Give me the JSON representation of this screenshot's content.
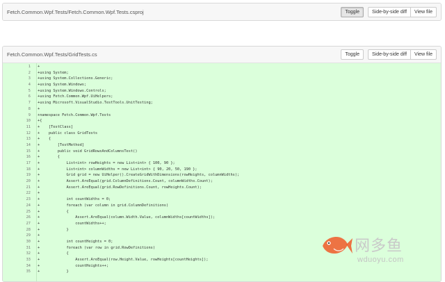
{
  "files": [
    {
      "path": "Fetch.Common.Wpf.Tests/Fetch.Common.Wpf.Tests.csproj",
      "toggle_label": "Toggle",
      "side_by_side_label": "Side-by-side diff",
      "view_file_label": "View file"
    },
    {
      "path": "Fetch.Common.Wpf.Tests/GridTests.cs",
      "toggle_label": "Toggle",
      "side_by_side_label": "Side-by-side diff",
      "view_file_label": "View file",
      "lines": [
        {
          "num": "1",
          "text": "+"
        },
        {
          "num": "2",
          "text": "+using System;"
        },
        {
          "num": "3",
          "text": "+using System.Collections.Generic;"
        },
        {
          "num": "4",
          "text": "+using System.Windows;"
        },
        {
          "num": "5",
          "text": "+using System.Windows.Controls;"
        },
        {
          "num": "6",
          "text": "+using Fetch.Common.Wpf.UiHelpers;"
        },
        {
          "num": "7",
          "text": "+using Microsoft.VisualStudio.TestTools.UnitTesting;"
        },
        {
          "num": "8",
          "text": "+"
        },
        {
          "num": "9",
          "text": "+namespace Fetch.Common.Wpf.Tests"
        },
        {
          "num": "10",
          "text": "+{"
        },
        {
          "num": "11",
          "text": "+    [TestClass]"
        },
        {
          "num": "12",
          "text": "+    public class GridTests"
        },
        {
          "num": "13",
          "text": "+    {"
        },
        {
          "num": "14",
          "text": "+        [TestMethod]"
        },
        {
          "num": "15",
          "text": "+        public void GridRowsAndColumnsTest()"
        },
        {
          "num": "16",
          "text": "+        {"
        },
        {
          "num": "17",
          "text": "+            List<int> rowHeights = new List<int> { 100, 90 };"
        },
        {
          "num": "18",
          "text": "+            List<int> columnWidths = new List<int> { 90, 20, 50, 190 };"
        },
        {
          "num": "19",
          "text": "+            Grid grid = new UiHelper().CreateGridWithDimensions(rowHeights, columnWidths);"
        },
        {
          "num": "20",
          "text": "+            Assert.AreEqual(grid.ColumnDefinitions.Count, columnWidths.Count);"
        },
        {
          "num": "21",
          "text": "+            Assert.AreEqual(grid.RowDefinitions.Count, rowHeights.Count);"
        },
        {
          "num": "22",
          "text": "+"
        },
        {
          "num": "23",
          "text": "+            int countWidths = 0;"
        },
        {
          "num": "24",
          "text": "+            foreach (var column in grid.ColumnDefinitions)"
        },
        {
          "num": "25",
          "text": "+            {"
        },
        {
          "num": "26",
          "text": "+                Assert.AreEqual(column.Width.Value, columnWidths[countWidths]);"
        },
        {
          "num": "27",
          "text": "+                countWidths++;"
        },
        {
          "num": "28",
          "text": "+            }"
        },
        {
          "num": "29",
          "text": "+"
        },
        {
          "num": "30",
          "text": "+            int countHeights = 0;"
        },
        {
          "num": "31",
          "text": "+            foreach (var row in grid.RowDefinitions)"
        },
        {
          "num": "32",
          "text": "+            {"
        },
        {
          "num": "33",
          "text": "+                Assert.AreEqual(row.Height.Value, rowHeights[countHeights]);"
        },
        {
          "num": "34",
          "text": "+                countHeights++;"
        },
        {
          "num": "35",
          "text": "+            }"
        }
      ]
    }
  ],
  "watermark": {
    "text_cn": "网多鱼",
    "url": "wduoyu.com",
    "color": "#f05a28"
  }
}
